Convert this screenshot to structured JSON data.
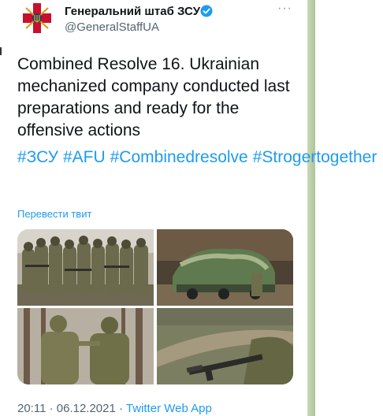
{
  "tweet": {
    "display_name": "Генеральний штаб ЗСУ",
    "handle": "@GeneralStaffUA",
    "more_icon": "···",
    "text": "Combined Resolve 16. Ukrainian mechanized company conducted last preparations and ready for the offensive actions",
    "hashtags": [
      "#ЗСУ",
      "#AFU",
      "#Combinedresolve",
      "#Strogertogether"
    ],
    "translate_label": "Перевести твит",
    "time": "20:11 · 06.12.2021 · ",
    "source": "Twitter Web App"
  },
  "icons": {
    "avatar": "general-staff-emblem",
    "verified": "verified-badge-icon",
    "more": "more-options-icon"
  },
  "photos": [
    {
      "name": "soldiers-group-photo"
    },
    {
      "name": "camouflaged-vehicle-photo"
    },
    {
      "name": "soldiers-forest-photo"
    },
    {
      "name": "rifle-field-photo"
    }
  ],
  "colors": {
    "accent": "#1d9bf0",
    "secondary_text": "#536471",
    "emblem_red": "#c8102e",
    "emblem_gold": "#d4a017"
  }
}
